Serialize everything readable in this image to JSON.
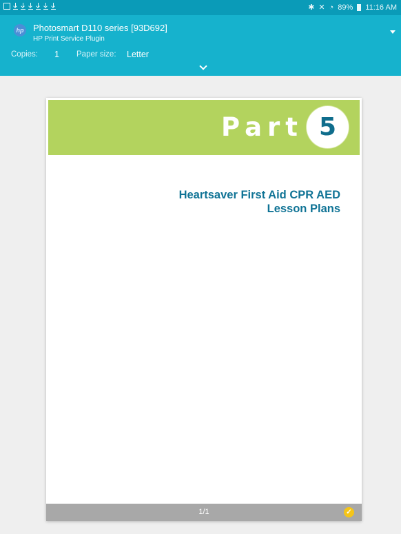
{
  "status_bar": {
    "battery": "89%",
    "time": "11:16 AM",
    "icons": [
      "gallery-icon",
      "download-icon",
      "download-icon",
      "download-icon",
      "download-icon",
      "download-icon",
      "download-icon",
      "bluetooth-icon",
      "mute-icon",
      "wifi-icon",
      "battery-icon"
    ]
  },
  "print_header": {
    "printer": "Photosmart D110 series [93D692]",
    "plugin": "HP Print Service Plugin",
    "copies_label": "Copies:",
    "copies_value": "1",
    "paper_label": "Paper size:",
    "paper_value": "Letter"
  },
  "preview": {
    "part_word": "Part",
    "part_number": "5",
    "title_line1": "Heartsaver First Aid CPR AED",
    "title_line2": "Lesson Plans",
    "page_indicator": "1/1",
    "banner_color": "#b3d35e",
    "title_color": "#0f7395"
  }
}
